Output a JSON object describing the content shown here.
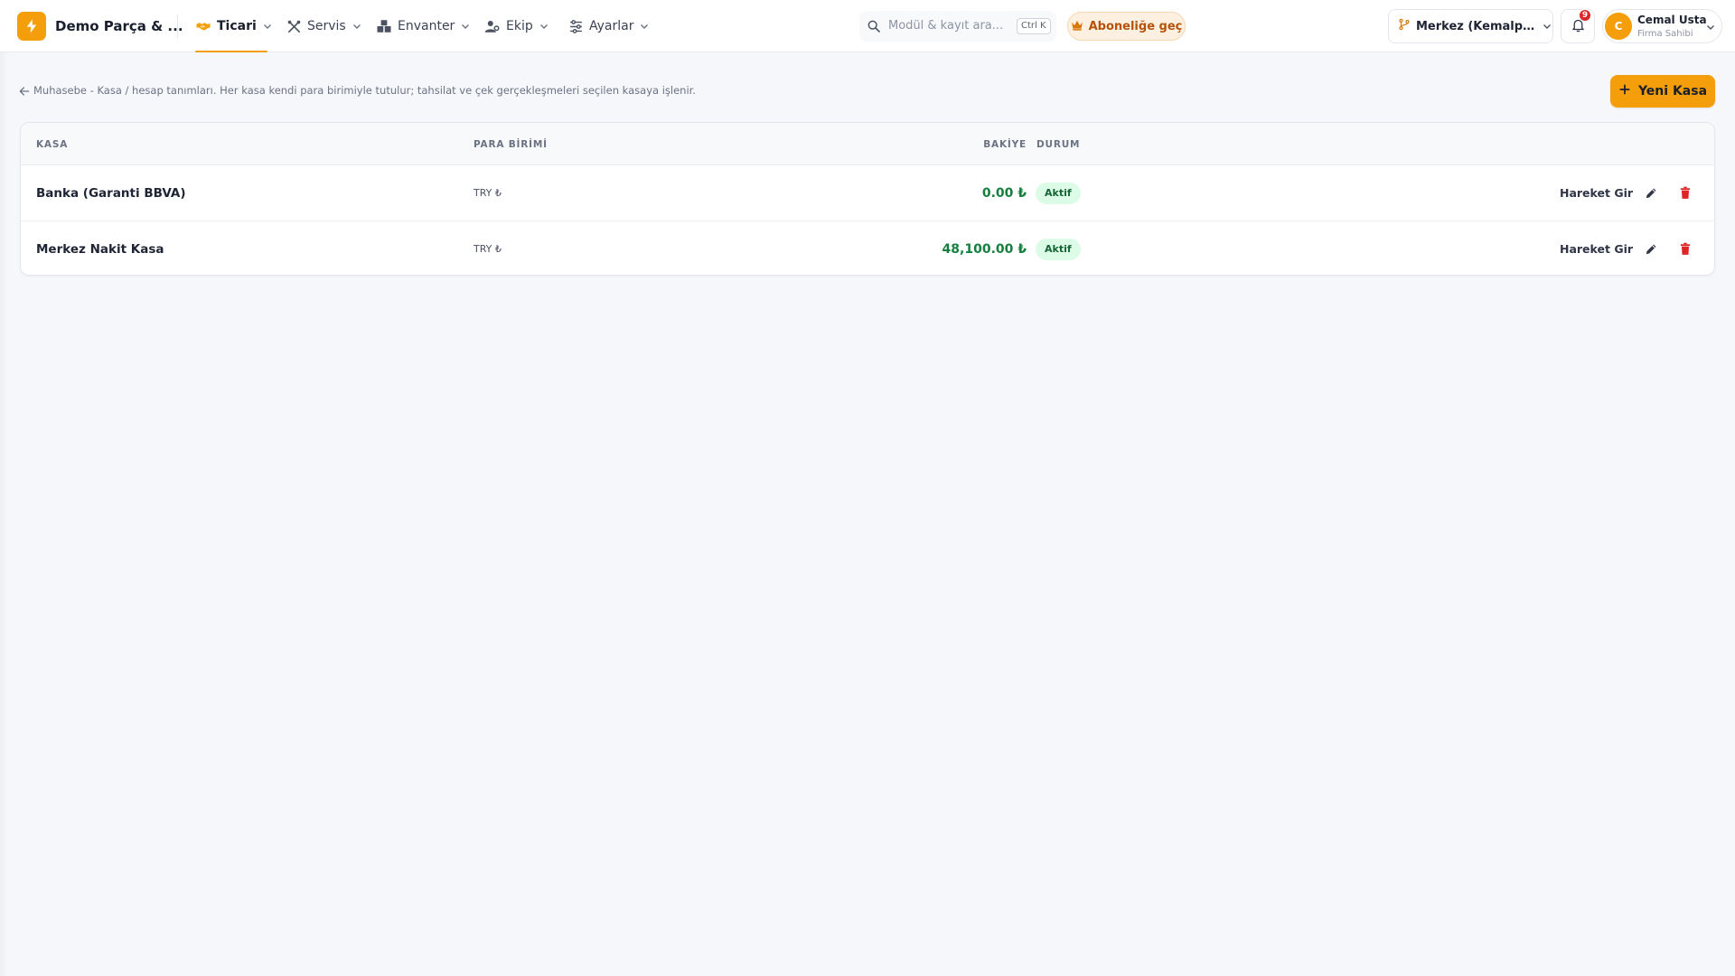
{
  "app": {
    "brand_name": "Demo Parça & ...",
    "accent_color": "#f59e0b"
  },
  "nav": {
    "items": [
      {
        "label": "Ticari",
        "icon": "handshake-icon",
        "active": true
      },
      {
        "label": "Servis",
        "icon": "tools-icon",
        "active": false
      },
      {
        "label": "Envanter",
        "icon": "boxes-icon",
        "active": false
      },
      {
        "label": "Ekip",
        "icon": "team-icon",
        "active": false
      },
      {
        "label": "Ayarlar",
        "icon": "sliders-icon",
        "active": false
      }
    ]
  },
  "search": {
    "placeholder": "Modül & kayıt ara...",
    "shortcut": "Ctrl K"
  },
  "subscribe": {
    "label": "Aboneliğe geç",
    "icon": "crown-icon"
  },
  "branch": {
    "label": "Merkez (Kemalpa...",
    "icon": "git-branch-icon"
  },
  "notifications": {
    "count": "9",
    "icon": "bell-icon"
  },
  "user": {
    "initial": "C",
    "name": "Cemal Usta",
    "role": "Firma Sahibi"
  },
  "page": {
    "description": "Muhasebe - Kasa / hesap tanımları. Her kasa kendi para birimiyle tutulur; tahsilat ve çek gerçekleşmeleri seçilen kasaya işlenir.",
    "new_button_label": "Yeni Kasa"
  },
  "table": {
    "columns": {
      "kasa": "KASA",
      "currency": "PARA BİRİMİ",
      "balance": "BAKİYE",
      "status": "DURUM"
    },
    "rows": [
      {
        "name": "Banka (Garanti BBVA)",
        "currency": "TRY ₺",
        "balance": "0.00 ₺",
        "status": "Aktif",
        "action_label": "Hareket Gir"
      },
      {
        "name": "Merkez Nakit Kasa",
        "currency": "TRY ₺",
        "balance": "48,100.00 ₺",
        "status": "Aktif",
        "action_label": "Hareket Gir"
      }
    ]
  },
  "colors": {
    "balance_positive": "#15803d",
    "status_active_bg": "#dcfce7",
    "delete": "#dc2626"
  }
}
